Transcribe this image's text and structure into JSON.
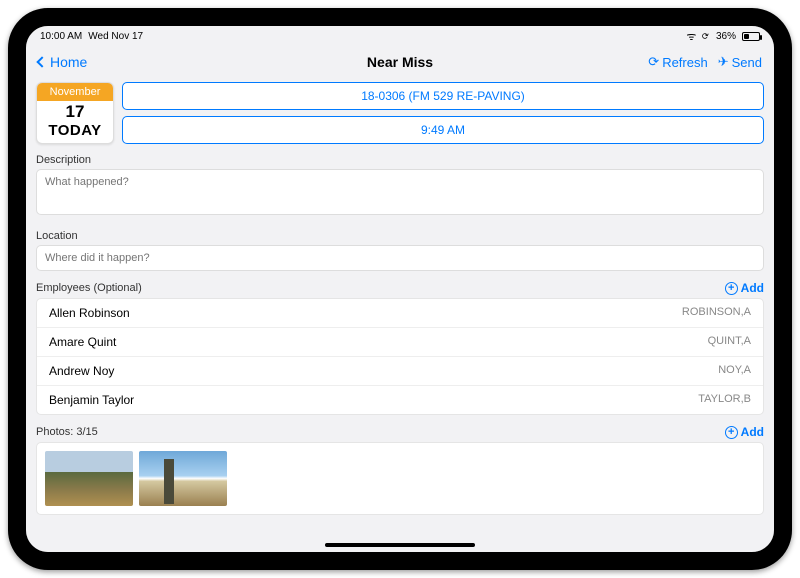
{
  "status": {
    "time": "10:00 AM",
    "date": "Wed Nov 17",
    "battery_pct": "36%"
  },
  "nav": {
    "back_label": "Home",
    "title": "Near Miss",
    "refresh": "Refresh",
    "send": "Send"
  },
  "calendar": {
    "month": "November",
    "day": "17",
    "today": "TODAY"
  },
  "top_buttons": {
    "project": "18-0306 (FM 529 RE-PAVING)",
    "time": "9:49 AM"
  },
  "labels": {
    "description": "Description",
    "location": "Location",
    "employees": "Employees (Optional)",
    "photos": "Photos: 3/15",
    "add": "Add"
  },
  "placeholders": {
    "description": "What happened?",
    "location": "Where did it happen?"
  },
  "employees": [
    {
      "name": "Allen Robinson",
      "code": "ROBINSON,A"
    },
    {
      "name": "Amare Quint",
      "code": "QUINT,A"
    },
    {
      "name": "Andrew Noy",
      "code": "NOY,A"
    },
    {
      "name": "Benjamin Taylor",
      "code": "TAYLOR,B"
    }
  ]
}
